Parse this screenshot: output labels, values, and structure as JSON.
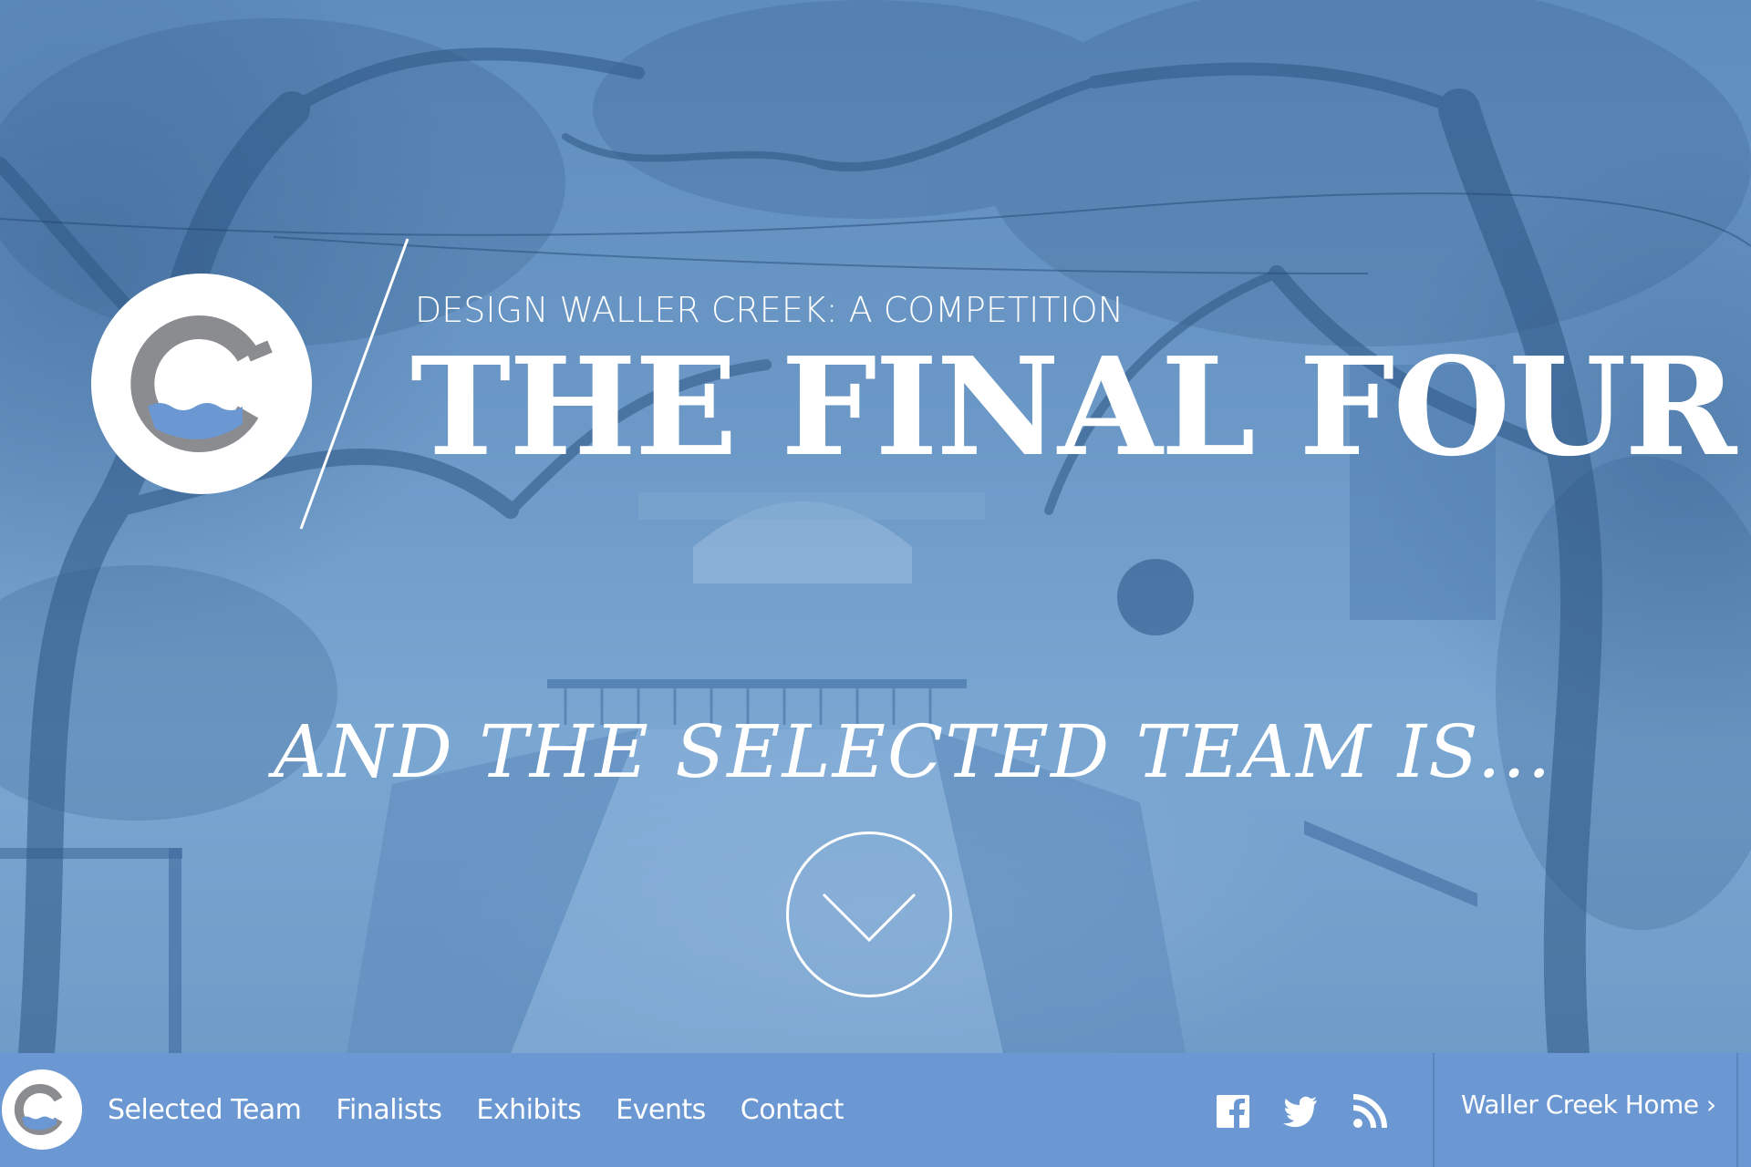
{
  "hero": {
    "kicker": "DESIGN WALLER CREEK: A COMPETITION",
    "title": "THE FINAL FOUR",
    "tagline": "AND THE SELECTED TEAM IS...",
    "scroll_icon": "chevron-down-icon",
    "background": "blue-tinted photo of Waller Creek with trees, bridge and canal"
  },
  "nav": {
    "links": [
      "Selected Team",
      "Finalists",
      "Exhibits",
      "Events",
      "Contact"
    ],
    "social_icons": [
      "facebook-icon",
      "twitter-icon",
      "rss-icon"
    ],
    "home_link": "Waller Creek Home ›"
  },
  "colors": {
    "nav_background": "#6b98d2",
    "logo_gray": "#8a8c8f",
    "logo_water": "#6b98d2",
    "text": "#ffffff"
  }
}
